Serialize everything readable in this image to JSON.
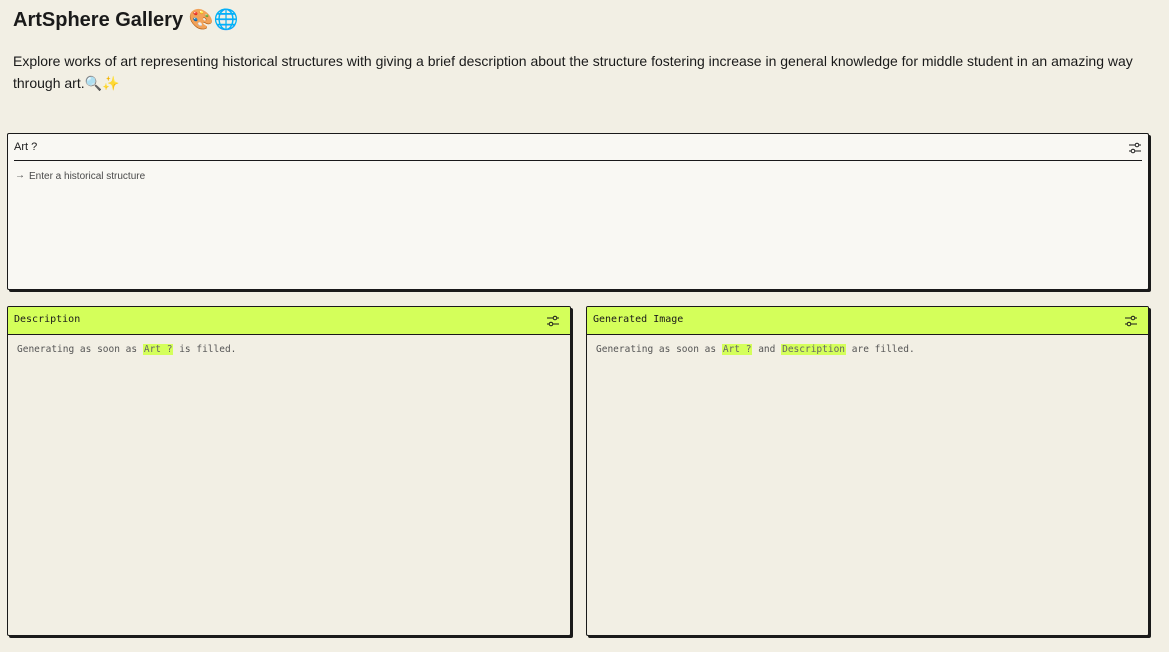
{
  "app": {
    "title": "ArtSphere Gallery 🎨🌐",
    "description": "Explore works of art representing historical structures with giving a brief description about the structure fostering increase in general knowledge for middle student in an amazing way through art.🔍✨"
  },
  "input_panel": {
    "label": "Art ?",
    "arrow": "→",
    "placeholder": "Enter a historical structure",
    "value": ""
  },
  "description_panel": {
    "label": "Description",
    "status": {
      "prefix": "Generating as soon as",
      "ref1": "Art ?",
      "suffix": "is filled."
    }
  },
  "image_panel": {
    "label": "Generated Image",
    "status": {
      "prefix": "Generating as soon as",
      "ref1": "Art ?",
      "joiner": "and",
      "ref2": "Description",
      "suffix": "are filled."
    }
  },
  "colors": {
    "background": "#f2efe4",
    "accent": "#d4ff5a",
    "border": "#1a1a1a"
  },
  "icons": [
    "settings-sliders-icon",
    "arrow-right-icon"
  ]
}
